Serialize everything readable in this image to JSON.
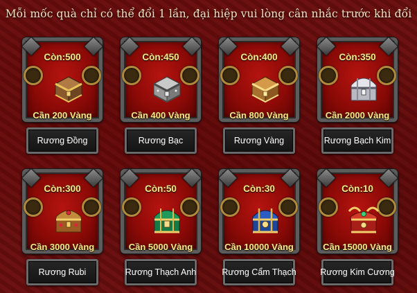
{
  "notice": "Mỗi mốc quà chỉ có thể đổi 1 lần, đại hiệp vui lòng cân nhắc trước khi đổi",
  "chests": [
    {
      "stock": "Còn:500",
      "price": "Cần 200 Vàng",
      "name": "Rương Đồng",
      "icon": "bronze-chest-icon"
    },
    {
      "stock": "Còn:450",
      "price": "Cần 400 Vàng",
      "name": "Rương Bạc",
      "icon": "silver-chest-icon"
    },
    {
      "stock": "Còn:400",
      "price": "Cần 800 Vàng",
      "name": "Rương Vàng",
      "icon": "gold-chest-icon"
    },
    {
      "stock": "Còn:350",
      "price": "Cần 2000 Vàng",
      "name": "Rương Bạch Kim",
      "icon": "platinum-chest-icon"
    },
    {
      "stock": "Còn:300",
      "price": "Cần 3000 Vàng",
      "name": "Rương Rubi",
      "icon": "ruby-chest-icon"
    },
    {
      "stock": "Còn:50",
      "price": "Cần 5000 Vàng",
      "name": "Rương Thạch Anh",
      "icon": "quartz-chest-icon"
    },
    {
      "stock": "Còn:30",
      "price": "Cần 10000 Vàng",
      "name": "Rương Cẩm Thạch",
      "icon": "jade-chest-icon"
    },
    {
      "stock": "Còn:10",
      "price": "Cần 15000 Vàng",
      "name": "Rương Kim Cương",
      "icon": "diamond-chest-icon"
    }
  ],
  "colors": {
    "background": "#6a0d0d",
    "price_text": "#ffe98a",
    "frame_inner": "#b5140f"
  }
}
